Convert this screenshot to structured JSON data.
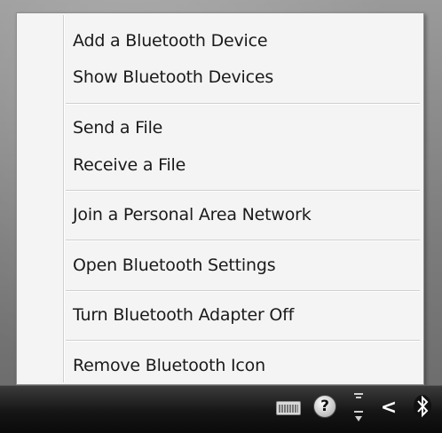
{
  "menu": {
    "items": [
      {
        "label": "Add a Bluetooth Device"
      },
      {
        "label": "Show Bluetooth Devices"
      },
      {
        "label": "Send a File"
      },
      {
        "label": "Receive a File"
      },
      {
        "label": "Join a Personal Area Network"
      },
      {
        "label": "Open Bluetooth Settings"
      },
      {
        "label": "Turn Bluetooth Adapter Off"
      },
      {
        "label": "Remove Bluetooth Icon"
      }
    ]
  },
  "tray": {
    "icons": [
      "keyboard-icon",
      "help-icon",
      "network-icon",
      "chevron-left-icon",
      "bluetooth-icon"
    ],
    "help_glyph": "?",
    "chevron_glyph": "<"
  }
}
